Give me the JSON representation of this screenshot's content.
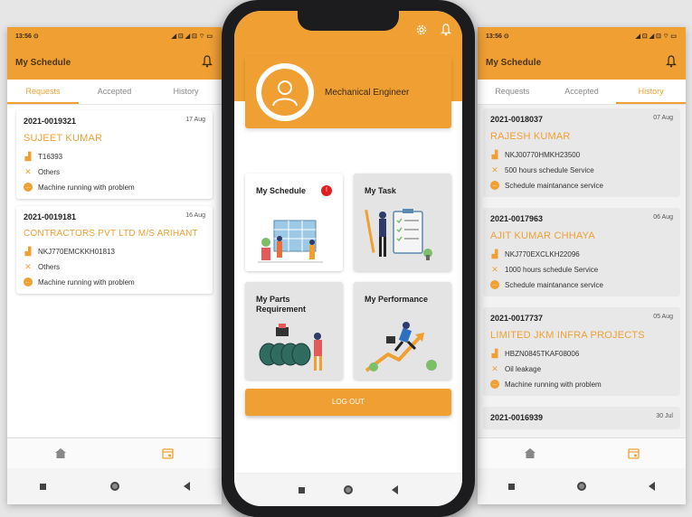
{
  "left": {
    "status_time": "13:56 ⊙",
    "status_icons": "◢ ⊡ ◢ ⊡ ⌔ ▭",
    "title": "My Schedule",
    "tabs": [
      "Requests",
      "Accepted",
      "History"
    ],
    "active_tab": "Requests",
    "cards": [
      {
        "id": "2021-0019321",
        "date": "17 Aug",
        "name": "SUJEET KUMAR",
        "machine": "T16393",
        "service": "Others",
        "issue": "Machine running with problem"
      },
      {
        "id": "2021-0019181",
        "date": "16 Aug",
        "name": "CONTRACTORS PVT LTD M/S ARIHANT",
        "machine": "NKJ770EMCKKH01813",
        "service": "Others",
        "issue": "Machine running with problem"
      }
    ]
  },
  "center": {
    "role": "Mechanical Engineer",
    "tiles": [
      {
        "label": "My Schedule",
        "badge": "!"
      },
      {
        "label": "My Task"
      },
      {
        "label": "My Parts Requirement"
      },
      {
        "label": "My Performance"
      }
    ],
    "logout": "LOG OUT"
  },
  "right": {
    "status_time": "13:56 ⊙",
    "status_icons": "◢ ⊡ ◢ ⊡ ⌔ ▭",
    "title": "My Schedule",
    "tabs": [
      "Requests",
      "Accepted",
      "History"
    ],
    "active_tab": "History",
    "cards": [
      {
        "id": "2021-0018037",
        "date": "07 Aug",
        "name": "RAJESH KUMAR",
        "machine": "NKJ00770HMKH23500",
        "service": "500 hours schedule Service",
        "issue": "Schedule maintanance service"
      },
      {
        "id": "2021-0017963",
        "date": "06 Aug",
        "name": "AJIT KUMAR CHHAYA",
        "machine": "NKJ770EXCLKH22096",
        "service": "1000 hours schedule Service",
        "issue": "Schedule maintanance service"
      },
      {
        "id": "2021-0017737",
        "date": "05 Aug",
        "name": "LIMITED JKM INFRA PROJECTS",
        "machine": "HBZN0845TKAF08006",
        "service": "Oil leakage",
        "issue": "Machine running with problem"
      },
      {
        "id": "2021-0016939",
        "date": "30 Jul"
      }
    ]
  },
  "colors": {
    "accent": "#f0a033",
    "badge": "#e02020"
  },
  "icons": [
    "bell-icon",
    "gear-icon",
    "home-icon",
    "calendar-icon",
    "machine-icon",
    "tools-icon",
    "message-icon",
    "user-avatar-icon"
  ]
}
